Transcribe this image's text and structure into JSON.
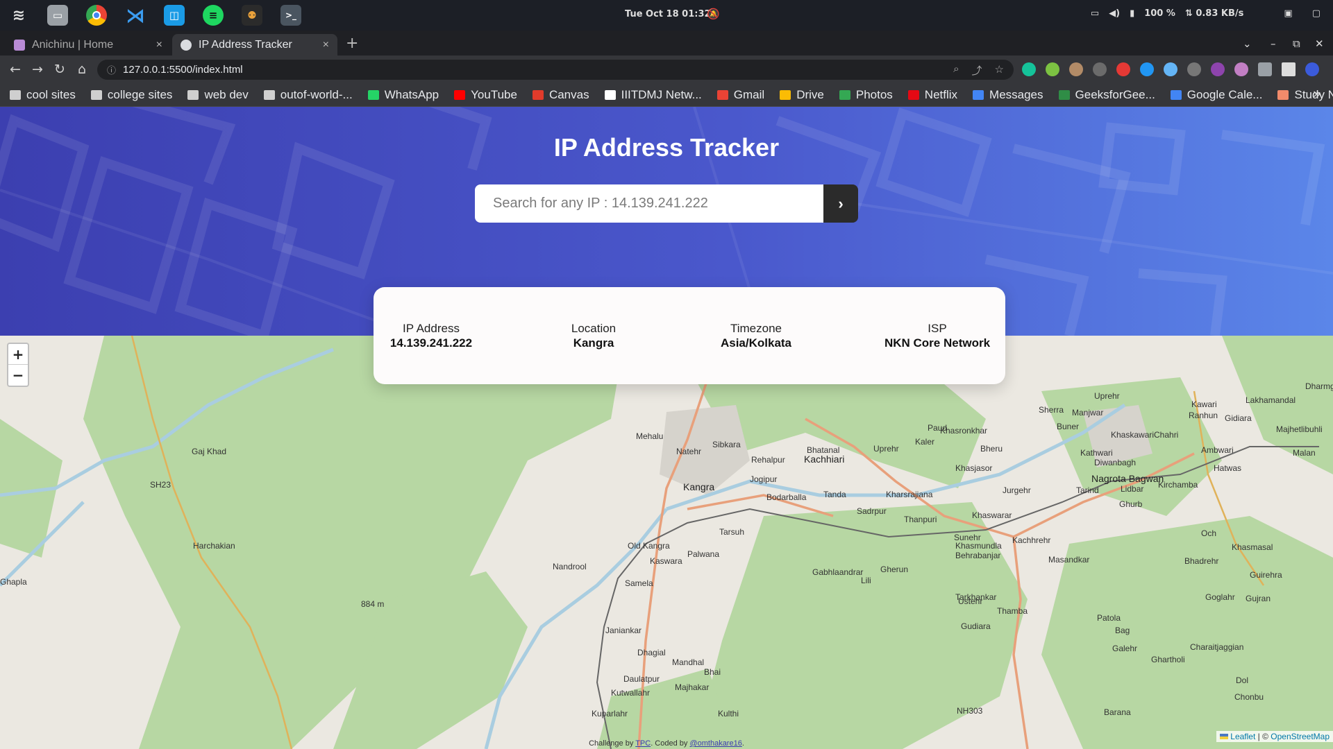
{
  "os": {
    "clock": "Tue Oct 18  01:32",
    "battery": "100 %",
    "network": "⇅ 0.83 KB/s"
  },
  "tabs": [
    {
      "title": "Anichinu | Home",
      "active": false
    },
    {
      "title": "IP Address Tracker",
      "active": true
    }
  ],
  "address_bar": {
    "url": "127.0.0.1:5500/index.html"
  },
  "bookmarks": [
    {
      "label": "cool sites",
      "icon": "folder-icon",
      "color": "#cfcfcf"
    },
    {
      "label": "college sites",
      "icon": "folder-icon",
      "color": "#cfcfcf"
    },
    {
      "label": "web dev",
      "icon": "folder-icon",
      "color": "#cfcfcf"
    },
    {
      "label": "outof-world-...",
      "icon": "folder-icon",
      "color": "#cfcfcf"
    },
    {
      "label": "WhatsApp",
      "icon": "whatsapp-icon",
      "color": "#25d366"
    },
    {
      "label": "YouTube",
      "icon": "youtube-icon",
      "color": "#ff0000"
    },
    {
      "label": "Canvas",
      "icon": "canvas-icon",
      "color": "#e13b2b"
    },
    {
      "label": "IIITDMJ Netw...",
      "icon": "globe-icon",
      "color": "#ffffff"
    },
    {
      "label": "Gmail",
      "icon": "gmail-icon",
      "color": "#ea4335"
    },
    {
      "label": "Drive",
      "icon": "drive-icon",
      "color": "#fbbc04"
    },
    {
      "label": "Photos",
      "icon": "photos-icon",
      "color": "#34a853"
    },
    {
      "label": "Netflix",
      "icon": "netflix-icon",
      "color": "#e50914"
    },
    {
      "label": "Messages",
      "icon": "messages-icon",
      "color": "#4285f4"
    },
    {
      "label": "GeeksforGee...",
      "icon": "geeksforgeeks-icon",
      "color": "#2f8d46"
    },
    {
      "label": "Google Cale...",
      "icon": "calendar-icon",
      "color": "#4285f4"
    },
    {
      "label": "Study Notes",
      "icon": "notes-icon",
      "color": "#f28b6b"
    }
  ],
  "app": {
    "title": "IP Address Tracker",
    "search_placeholder": "Search for any IP : 14.139.241.222",
    "submit_label": "›",
    "stats": [
      {
        "label": "IP Address",
        "value": "14.139.241.222"
      },
      {
        "label": "Location",
        "value": "Kangra"
      },
      {
        "label": "Timezone",
        "value": "Asia/Kolkata"
      },
      {
        "label": "ISP",
        "value": "NKN Core Network"
      }
    ]
  },
  "map": {
    "zoom_in": "+",
    "zoom_out": "−",
    "attribution_leaflet": "Leaflet",
    "attribution_sep": " | © ",
    "attribution_osm": "OpenStreetMap",
    "labels": [
      {
        "text": "Kangra",
        "big": true
      },
      {
        "text": "Kachhiari",
        "big": true
      },
      {
        "text": "Nagrota Bagwan",
        "big": true
      },
      {
        "text": "Old Kangra",
        "big": false
      },
      {
        "text": "Kaswara",
        "big": false
      },
      {
        "text": "Palwana",
        "big": false
      },
      {
        "text": "Samela",
        "big": false
      },
      {
        "text": "Nandrool",
        "big": false
      },
      {
        "text": "Tarsuh",
        "big": false
      },
      {
        "text": "Jogipur",
        "big": false
      },
      {
        "text": "Bodarballa",
        "big": false
      },
      {
        "text": "Tanda",
        "big": false
      },
      {
        "text": "Sadrpur",
        "big": false
      },
      {
        "text": "Kharsrajiana",
        "big": false
      },
      {
        "text": "Thanpuri",
        "big": false
      },
      {
        "text": "Khaswarar",
        "big": false
      },
      {
        "text": "Sunehr",
        "big": false
      },
      {
        "text": "Kachhrehr",
        "big": false
      },
      {
        "text": "Khasmundla",
        "big": false
      },
      {
        "text": "Behrabanjar",
        "big": false
      },
      {
        "text": "Masandkar",
        "big": false
      },
      {
        "text": "Gabhlaandrar",
        "big": false
      },
      {
        "text": "Gherun",
        "big": false
      },
      {
        "text": "Ustehr",
        "big": false
      },
      {
        "text": "Tarkhankar",
        "big": false
      },
      {
        "text": "Thamba",
        "big": false
      },
      {
        "text": "Gudiara",
        "big": false
      },
      {
        "text": "Janiankar",
        "big": false
      },
      {
        "text": "Dhagial",
        "big": false
      },
      {
        "text": "Mandhal",
        "big": false
      },
      {
        "text": "Bhai",
        "big": false
      },
      {
        "text": "Daulatpur",
        "big": false
      },
      {
        "text": "Majhakar",
        "big": false
      },
      {
        "text": "Kutwallahr",
        "big": false
      },
      {
        "text": "Kuparlahr",
        "big": false
      },
      {
        "text": "Kulthi",
        "big": false
      },
      {
        "text": "Mehalu",
        "big": false
      },
      {
        "text": "Natehr",
        "big": false
      },
      {
        "text": "Sibkara",
        "big": false
      },
      {
        "text": "Rehalpur",
        "big": false
      },
      {
        "text": "Bhatanal",
        "big": false
      },
      {
        "text": "Uprehr",
        "big": false
      },
      {
        "text": "Kaler",
        "big": false
      },
      {
        "text": "Paud",
        "big": false
      },
      {
        "text": "Khasronkhar",
        "big": false
      },
      {
        "text": "Bheru",
        "big": false
      },
      {
        "text": "Khasjasor",
        "big": false
      },
      {
        "text": "Jurgehr",
        "big": false
      },
      {
        "text": "Tarind",
        "big": false
      },
      {
        "text": "Lidbar",
        "big": false
      },
      {
        "text": "Ghurb",
        "big": false
      },
      {
        "text": "Kirchamba",
        "big": false
      },
      {
        "text": "Hatwas",
        "big": false
      },
      {
        "text": "Kathwari",
        "big": false
      },
      {
        "text": "Diwanbagh",
        "big": false
      },
      {
        "text": "Khaskawari",
        "big": false
      },
      {
        "text": "Chahri",
        "big": false
      },
      {
        "text": "Ambwari",
        "big": false
      },
      {
        "text": "Malan",
        "big": false
      },
      {
        "text": "Kawari",
        "big": false
      },
      {
        "text": "Ranhun",
        "big": false
      },
      {
        "text": "Gidiara",
        "big": false
      },
      {
        "text": "Lakhamandal",
        "big": false
      },
      {
        "text": "Majhetlibuhli",
        "big": false
      },
      {
        "text": "Dharmgir",
        "big": false
      },
      {
        "text": "Uprehr",
        "big": false
      },
      {
        "text": "Manjwar",
        "big": false
      },
      {
        "text": "Sherra",
        "big": false
      },
      {
        "text": "Buner",
        "big": false
      },
      {
        "text": "Och",
        "big": false
      },
      {
        "text": "Khasmasal",
        "big": false
      },
      {
        "text": "Bhadrehr",
        "big": false
      },
      {
        "text": "Guirehra",
        "big": false
      },
      {
        "text": "Goglahr",
        "big": false
      },
      {
        "text": "Gujran",
        "big": false
      },
      {
        "text": "Patola",
        "big": false
      },
      {
        "text": "Bag",
        "big": false
      },
      {
        "text": "Charaitjaggian",
        "big": false
      },
      {
        "text": "Galehr",
        "big": false
      },
      {
        "text": "Ghartholi",
        "big": false
      },
      {
        "text": "Dol",
        "big": false
      },
      {
        "text": "Chonbu",
        "big": false
      },
      {
        "text": "Barana",
        "big": false
      },
      {
        "text": "Lili",
        "big": false
      },
      {
        "text": "Ghapla",
        "big": false
      },
      {
        "text": "Harchakian",
        "big": false
      },
      {
        "text": "Gaj Khad",
        "big": false
      },
      {
        "text": "SH23",
        "big": false
      },
      {
        "text": "NH303",
        "big": false
      },
      {
        "text": "884 m",
        "big": false
      }
    ]
  },
  "credit": {
    "prefix": "Challenge by ",
    "link1": "TPC",
    "middle": ". Coded by ",
    "link2": "@omthakare16",
    "suffix": "."
  }
}
